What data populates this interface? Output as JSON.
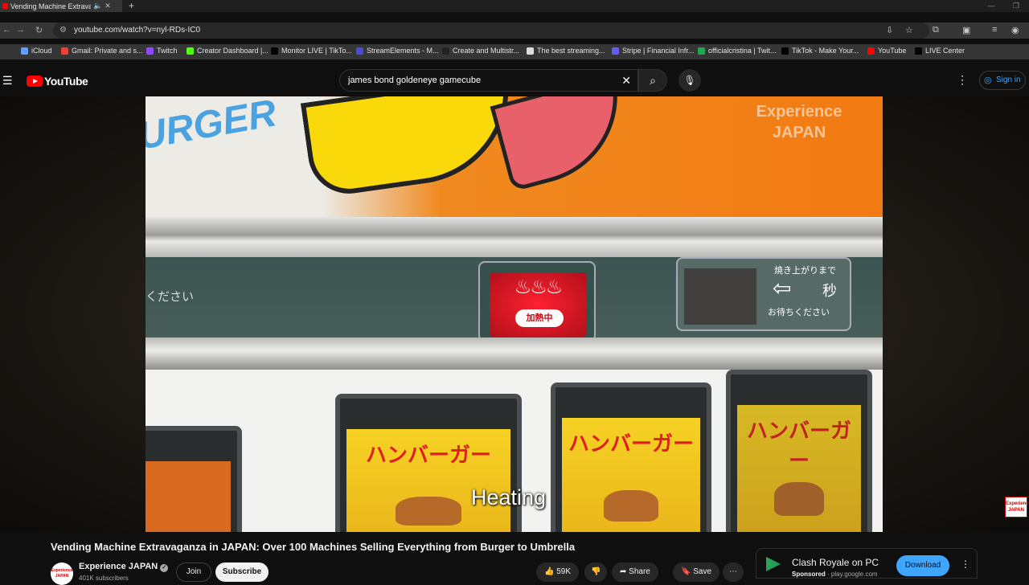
{
  "browser": {
    "tab_title": "Vending Machine Extravaga",
    "new_tab": "+",
    "url": "youtube.com/watch?v=nyl-RDs-IC0",
    "bookmarks": [
      {
        "label": "iCloud",
        "color": "#5ea0ff"
      },
      {
        "label": "Gmail: Private and s...",
        "color": "#ea4335"
      },
      {
        "label": "Twitch",
        "color": "#9146ff"
      },
      {
        "label": "Creator Dashboard |...",
        "color": "#53fc18"
      },
      {
        "label": "Monitor LIVE | TikTo...",
        "color": "#000000"
      },
      {
        "label": "StreamElements - M...",
        "color": "#4b4bd6"
      },
      {
        "label": "Create and Multistr...",
        "color": "#222222"
      },
      {
        "label": "The best streaming...",
        "color": "#dddddd"
      },
      {
        "label": "Stripe | Financial Infr...",
        "color": "#635bff"
      },
      {
        "label": "officialcristina | Twit...",
        "color": "#1da851"
      },
      {
        "label": "TikTok - Make Your...",
        "color": "#000000"
      },
      {
        "label": "YouTube",
        "color": "#ff0000"
      },
      {
        "label": "LIVE Center",
        "color": "#000000"
      }
    ]
  },
  "youtube": {
    "logo_text": "YouTube",
    "search_query": "james bond goldeneye gamecube",
    "sign_in": "Sign in"
  },
  "video": {
    "caption": "Heating",
    "watermark": "Experience JAPAN",
    "scene_text_left": "ください",
    "burger_sign": "URGER",
    "heating_label": "加熱中",
    "wait_line1": "焼き上がりまで",
    "wait_line2": "秒",
    "wait_line3": "お待ちください",
    "slot_label": "ハンバーガー",
    "mini_watermark": "Experience JAPAN"
  },
  "meta": {
    "title": "Vending Machine Extravaganza in JAPAN: Over 100 Machines Selling Everything from Burger to Umbrella",
    "channel_name": "Experience JAPAN",
    "subscribers": "401K subscribers",
    "avatar_text": "Experience JAPAN",
    "join": "Join",
    "subscribe": "Subscribe",
    "likes": "59K",
    "share": "Share",
    "save": "Save"
  },
  "ad": {
    "name": "Clash Royale on PC",
    "sponsored": "Sponsored",
    "domain": "play.google.com",
    "cta": "Download"
  }
}
